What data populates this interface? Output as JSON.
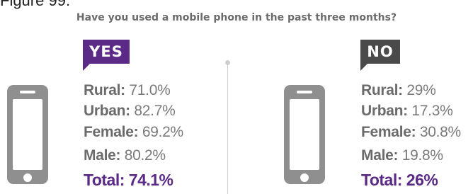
{
  "figure_label": "Figure 99:",
  "question": "Have you used a mobile phone in the past three months?",
  "colors": {
    "yes": "#5b2a86",
    "no": "#4a4a4a",
    "label_text": "#6b6b6b",
    "value_text": "#7a7a7a",
    "phone": "#8f8f8f"
  },
  "chart_data": {
    "type": "table",
    "title": "Have you used a mobile phone in the past three months?",
    "groups": [
      "Rural",
      "Urban",
      "Female",
      "Male",
      "Total"
    ],
    "answers": [
      {
        "answer": "YES",
        "values": {
          "Rural": 71.0,
          "Urban": 82.7,
          "Female": 69.2,
          "Male": 80.2,
          "Total": 74.1
        },
        "display": {
          "rural_label": "Rural:",
          "rural_value": "71.0%",
          "urban_label": "Urban:",
          "urban_value": "82.7%",
          "female_label": "Female:",
          "female_value": "69.2%",
          "male_label": "Male:",
          "male_value": "80.2%",
          "total": "Total: 74.1%"
        }
      },
      {
        "answer": "NO",
        "values": {
          "Rural": 29,
          "Urban": 17.3,
          "Female": 30.8,
          "Male": 19.8,
          "Total": 26
        },
        "display": {
          "rural_label": "Rural:",
          "rural_value": "29%",
          "urban_label": "Urban:",
          "urban_value": "17.3%",
          "female_label": "Female:",
          "female_value": "30.8%",
          "male_label": "Male:",
          "male_value": "19.8%",
          "total": "Total: 26%"
        }
      }
    ]
  }
}
